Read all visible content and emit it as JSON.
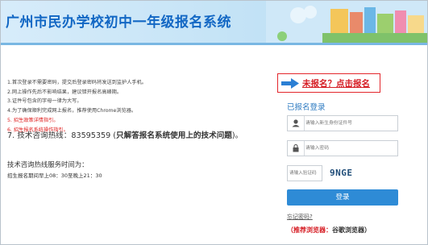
{
  "banner": {
    "title": "广州市民办学校初中一年级报名系统"
  },
  "notes": [
    {
      "text": "1.首次登录不需要密码，提交后登录密码将发送到监护人手机。",
      "highlight": false
    },
    {
      "text": "2.网上操作先后不影响结果，建议错开报名高峰期。",
      "highlight": false
    },
    {
      "text": "3.证件号包含的字母一律为大写。",
      "highlight": false
    },
    {
      "text": "4.为了确保顺利完成网上报名，推荐使用Chrome浏览器。",
      "highlight": false
    },
    {
      "text": "5. 招生政策详情指引。",
      "highlight": true
    },
    {
      "text": "6. 招生报名系统操作指引。",
      "highlight": true
    }
  ],
  "hotline": {
    "line1_prefix": "7. 技术咨询热线：83595359 (",
    "line1_bold": "只解答报名系统使用上的技术问题",
    "line1_suffix": ")。",
    "hours_label": "技术咨询热线服务时间为：",
    "hours": "招生报名期间早上08：30至晚上21：30"
  },
  "register": {
    "link": "未报名？点击报名"
  },
  "login": {
    "title": "已报名登录",
    "id_placeholder": "请输入新生身份证件号",
    "password_placeholder": "请输入密码",
    "captcha_placeholder": "请输入验证码",
    "captcha_code": "9NGE",
    "button": "登录",
    "forgot": "忘记密码?"
  },
  "browser": {
    "label": "（推荐浏览器：",
    "value": "谷歌浏览器）"
  },
  "colors": {
    "brand_blue": "#1267c4",
    "accent_red": "#d61f26",
    "button_blue": "#2e8bd6"
  },
  "icons": [
    "user-icon",
    "lock-icon",
    "arrow-right-icon"
  ]
}
